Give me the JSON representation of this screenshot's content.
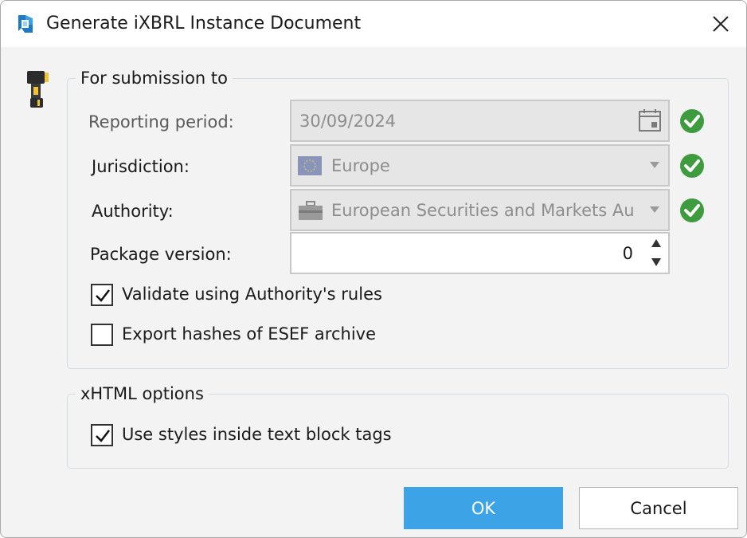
{
  "window": {
    "title": "Generate iXBRL Instance Document",
    "icon": "xbrl-logo-icon"
  },
  "submission": {
    "legend": "For submission to",
    "reporting_period": {
      "label": "Reporting period:",
      "value": "30/09/2024"
    },
    "jurisdiction": {
      "label": "Jurisdiction:",
      "value": "Europe"
    },
    "authority": {
      "label": "Authority:",
      "value": "European Securities and Markets Au"
    },
    "package_version": {
      "label": "Package version:",
      "value": "0"
    },
    "validate": {
      "label": "Validate using Authority's rules",
      "checked": true
    },
    "export_hashes": {
      "label": "Export hashes of ESEF archive",
      "checked": false
    }
  },
  "xhtml": {
    "legend": "xHTML options",
    "use_styles": {
      "label": "Use styles inside text block tags",
      "checked": true
    }
  },
  "buttons": {
    "ok": "OK",
    "cancel": "Cancel"
  },
  "colors": {
    "accent": "#3ba3e6",
    "valid_green": "#3e9b3e"
  }
}
